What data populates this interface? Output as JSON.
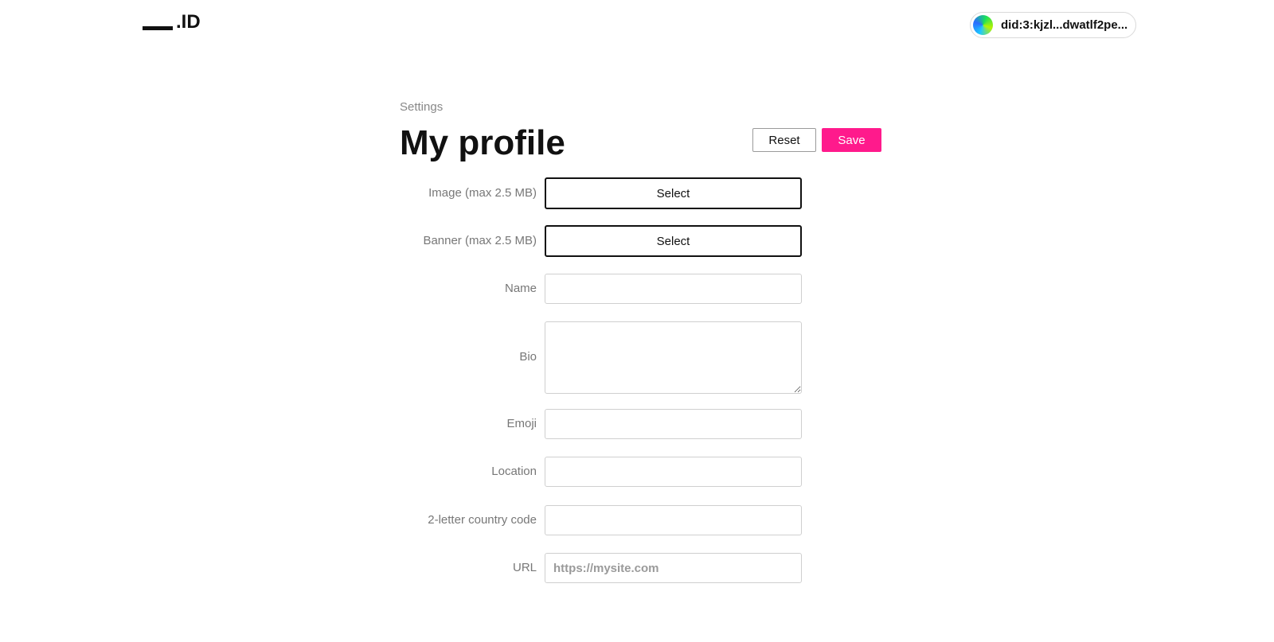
{
  "header": {
    "logo_text": ".ID",
    "account_id": "did:3:kjzl...dwatlf2pe..."
  },
  "page": {
    "breadcrumb": "Settings",
    "title": "My profile",
    "reset_label": "Reset",
    "save_label": "Save"
  },
  "form": {
    "image": {
      "label": "Image (max 2.5 MB)",
      "button": "Select"
    },
    "banner": {
      "label": "Banner (max 2.5 MB)",
      "button": "Select"
    },
    "name": {
      "label": "Name",
      "value": "",
      "placeholder": ""
    },
    "bio": {
      "label": "Bio",
      "value": "",
      "placeholder": ""
    },
    "emoji": {
      "label": "Emoji",
      "value": "",
      "placeholder": ""
    },
    "location": {
      "label": "Location",
      "value": "",
      "placeholder": ""
    },
    "country": {
      "label": "2-letter country code",
      "value": "",
      "placeholder": ""
    },
    "url": {
      "label": "URL",
      "value": "",
      "placeholder": "https://mysite.com"
    }
  },
  "colors": {
    "accent": "#ff1a8c",
    "label": "#777777",
    "border": "#cfcfcf"
  }
}
